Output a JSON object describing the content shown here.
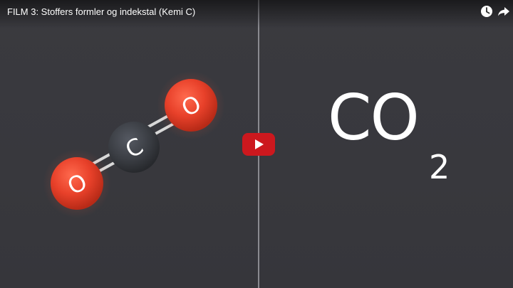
{
  "video": {
    "title": "FILM 3: Stoffers formler og indekstal (Kemi C)"
  },
  "topbar": {
    "icons": [
      "watch-later-icon",
      "share-icon"
    ]
  },
  "molecule": {
    "atoms": [
      {
        "symbol": "O",
        "color": "#e8412a"
      },
      {
        "symbol": "C",
        "color": "#3b3e44"
      },
      {
        "symbol": "O",
        "color": "#e8412a"
      }
    ]
  },
  "formula": {
    "main": "CO",
    "subscript": "2"
  },
  "colors": {
    "background": "#38383d",
    "play_button": "#cc181e",
    "oxygen": "#e8412a",
    "carbon": "#3b3e44"
  }
}
